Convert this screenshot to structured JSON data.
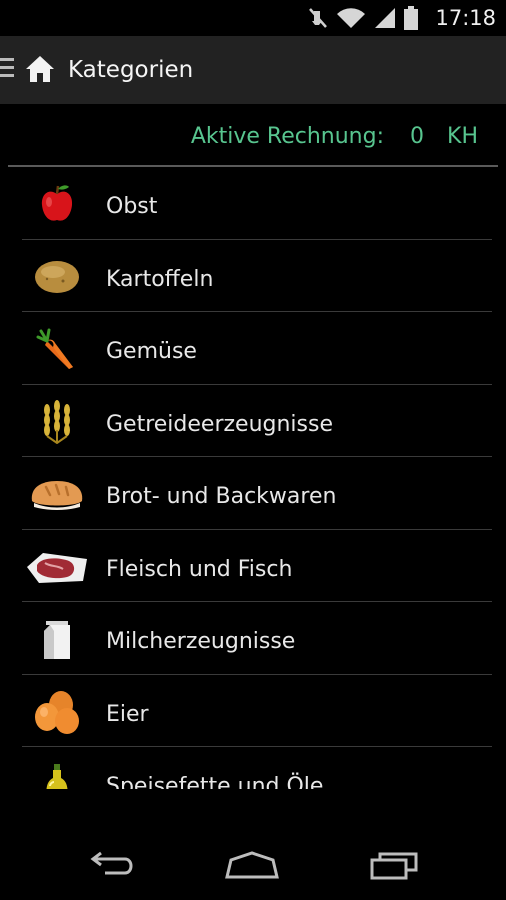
{
  "status_bar": {
    "time": "17:18",
    "icons": [
      "mute-icon",
      "wifi-icon",
      "signal-icon",
      "battery-icon"
    ]
  },
  "action_bar": {
    "title": "Kategorien",
    "menu_icon": "hamburger-icon",
    "home_icon": "home-icon"
  },
  "active_bill": {
    "label": "Aktive Rechnung:",
    "value": "0",
    "unit": "KH",
    "color": "#58c58f"
  },
  "categories": [
    {
      "label": "Obst",
      "icon": "apple-icon"
    },
    {
      "label": "Kartoffeln",
      "icon": "potato-icon"
    },
    {
      "label": "Gemüse",
      "icon": "carrot-icon"
    },
    {
      "label": "Getreideerzeugnisse",
      "icon": "wheat-icon"
    },
    {
      "label": "Brot- und Backwaren",
      "icon": "bread-icon"
    },
    {
      "label": "Fleisch und Fisch",
      "icon": "meat-icon"
    },
    {
      "label": "Milcherzeugnisse",
      "icon": "milk-carton-icon"
    },
    {
      "label": "Eier",
      "icon": "eggs-icon"
    },
    {
      "label": "Speisefette und Öle",
      "icon": "oil-bottle-icon"
    }
  ],
  "nav_bar": {
    "buttons": [
      "back-icon",
      "home-nav-icon",
      "recent-apps-icon"
    ]
  }
}
